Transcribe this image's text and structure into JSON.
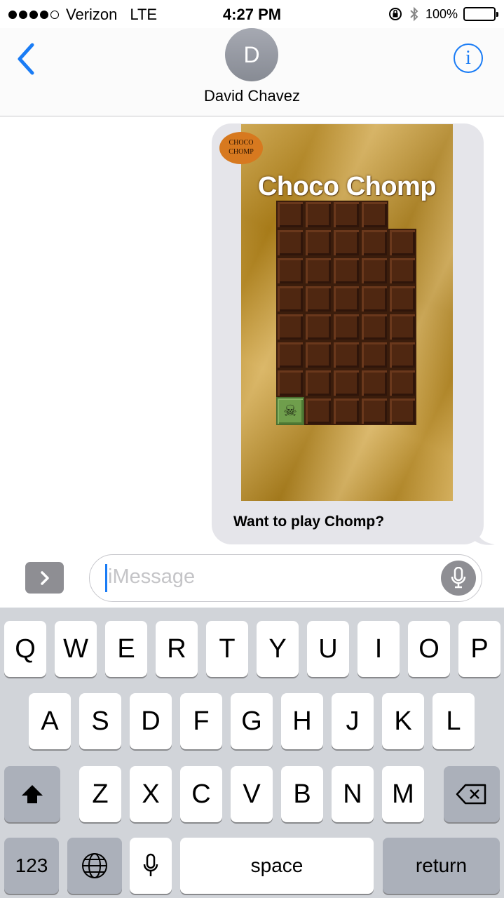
{
  "status_bar": {
    "carrier": "Verizon",
    "network": "LTE",
    "time": "4:27 PM",
    "battery": "100%",
    "battery_level": 1.0,
    "signal_bars": 4
  },
  "header": {
    "avatar_initial": "D",
    "contact_name": "David Chavez",
    "info_glyph": "i"
  },
  "message": {
    "app_badge": "CHOCO CHOMP",
    "game_title": "Choco Chomp",
    "caption": "Want to play Chomp?",
    "board": {
      "columns": 5,
      "rows": 8,
      "missing_top_right": 1,
      "poison_glyph": "☠"
    }
  },
  "input": {
    "placeholder": "iMessage"
  },
  "keyboard": {
    "row1": [
      "Q",
      "W",
      "E",
      "R",
      "T",
      "Y",
      "U",
      "I",
      "O",
      "P"
    ],
    "row2": [
      "A",
      "S",
      "D",
      "F",
      "G",
      "H",
      "J",
      "K",
      "L"
    ],
    "row3": [
      "Z",
      "X",
      "C",
      "V",
      "B",
      "N",
      "M"
    ],
    "numbers_key": "123",
    "space_key": "space",
    "return_key": "return"
  },
  "colors": {
    "accent": "#1a7cf5",
    "bubble": "#e5e5ea",
    "chocolate": "#4f2711",
    "poison": "#6f9e4c",
    "foil": "#c9941e"
  }
}
